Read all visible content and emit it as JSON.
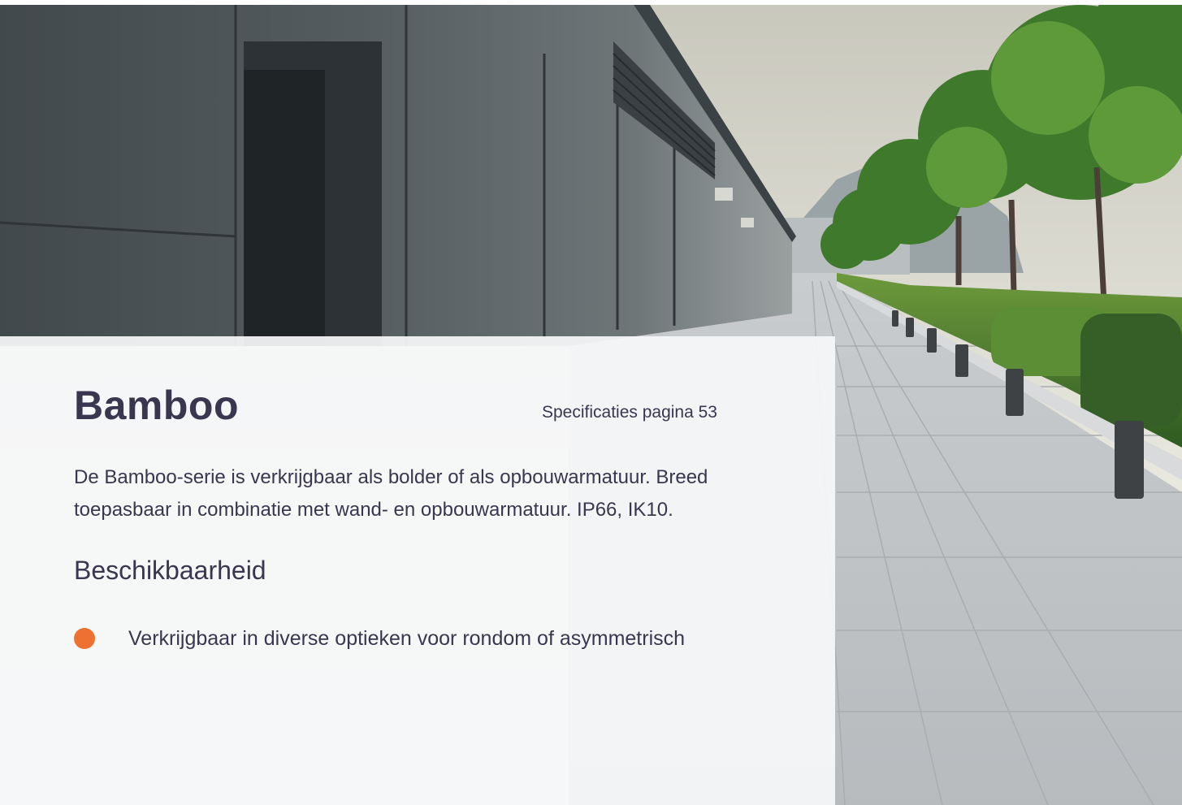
{
  "product": {
    "title": "Bamboo",
    "spec_link": "Specificaties pagina 53",
    "description": "De Bamboo-serie is verkrijgbaar als bolder of als opbouwarmatuur. Breed toepasbaar in combinatie met wand- en opbouwarmatuur. IP66, IK10."
  },
  "availability": {
    "heading": "Beschikbaarheid",
    "items": [
      {
        "text": "Verkrijgbaar in diverse optieken voor rondom of asymmetrisch"
      }
    ]
  },
  "colors": {
    "accent": "#ef7132",
    "text": "#3a3650",
    "panel": "#f6f7f9"
  }
}
